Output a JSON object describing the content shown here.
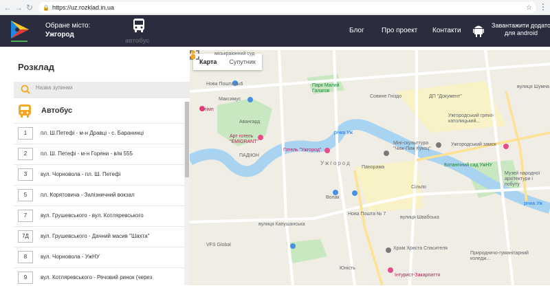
{
  "browser": {
    "url": "https://uz.rozklad.in.ua"
  },
  "header": {
    "city_prefix": "Обране місто:",
    "city_name": "Ужгород",
    "mode_label": "автобус",
    "nav": [
      "Блог",
      "Про проект",
      "Контакти"
    ],
    "android_line1": "Завантажити додато",
    "android_line2": "для android",
    "colors": {
      "bg": "#2b2d3f",
      "accent": "#f5a623"
    }
  },
  "sidebar": {
    "title": "Розклад",
    "search_placeholder": "Назва зупинки",
    "transport_label": "Автобус",
    "routes": [
      {
        "num": "1",
        "name": "пл. Ш.Петефі - м-н Дравці - с. Баранинці"
      },
      {
        "num": "2",
        "name": "пл. Ш. Петефі - м-н Горяни - в/м 555"
      },
      {
        "num": "3",
        "name": "вул. Чорновола - пл. Ш. Петефі"
      },
      {
        "num": "5",
        "name": "пл. Корятовича - Залізничний вокзал"
      },
      {
        "num": "7",
        "name": "вул. Грушевського - вул. Котляревського"
      },
      {
        "num": "7Д",
        "name": "вул. Грушевського - Дачний масив \"Шахта\""
      },
      {
        "num": "8",
        "name": "вул. Чорновола - УжНУ"
      },
      {
        "num": "9",
        "name": "вул. Котляревського - Речовий ринок (через"
      }
    ]
  },
  "map": {
    "tabs": [
      "Карта",
      "Супутник"
    ],
    "labels": [
      {
        "text": "міськраіонний суд",
        "cls": ""
      },
      {
        "text": "Нова Пошта №6",
        "cls": ""
      },
      {
        "text": "Парк Малий Галагов",
        "cls": "green"
      },
      {
        "text": "Максимус",
        "cls": ""
      },
      {
        "text": "Совине Гніздо",
        "cls": ""
      },
      {
        "text": "ДП \"Документ\"",
        "cls": ""
      },
      {
        "text": "Авангард",
        "cls": ""
      },
      {
        "text": "Олімп",
        "cls": "pink"
      },
      {
        "text": "Ужгородський греко-католицький...",
        "cls": ""
      },
      {
        "text": "Арт готель \"EMIGRANT\"",
        "cls": "pink"
      },
      {
        "text": "річка Уж",
        "cls": "blue"
      },
      {
        "text": "ПАДІЮН",
        "cls": ""
      },
      {
        "text": "Готель \"Ужгород\"",
        "cls": "pink"
      },
      {
        "text": "Міні-скульптура \"Чиж-Пиж Кукоц\"",
        "cls": ""
      },
      {
        "text": "Ужгородський замок",
        "cls": ""
      },
      {
        "text": "Ужгород",
        "cls": "district"
      },
      {
        "text": "Панорама",
        "cls": ""
      },
      {
        "text": "Ботанічний сад УжНУ",
        "cls": "green"
      },
      {
        "text": "Сільпо",
        "cls": ""
      },
      {
        "text": "Музей народної архітектури і побуту",
        "cls": ""
      },
      {
        "text": "Волак",
        "cls": ""
      },
      {
        "text": "Нова Пошта № 7",
        "cls": ""
      },
      {
        "text": "VFS Global",
        "cls": ""
      },
      {
        "text": "Храм Христа Спасителя",
        "cls": ""
      },
      {
        "text": "Юність",
        "cls": ""
      },
      {
        "text": "Інтурист-Закарпаття",
        "cls": "pink"
      },
      {
        "text": "Природничо-гуманітарний коледж...",
        "cls": ""
      },
      {
        "text": "вулиця Капушанська",
        "cls": ""
      },
      {
        "text": "вулиця Швабська",
        "cls": ""
      },
      {
        "text": "вулиця Шумна",
        "cls": ""
      },
      {
        "text": "річка Уж",
        "cls": "blue"
      }
    ]
  }
}
